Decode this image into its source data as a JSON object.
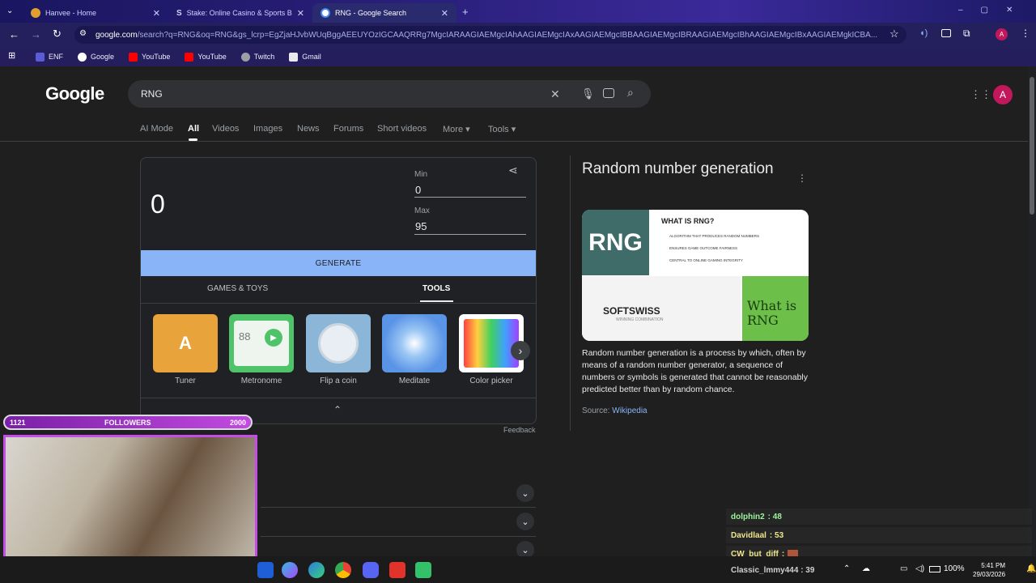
{
  "browser": {
    "tabs": [
      {
        "label": "Hanvee - Home"
      },
      {
        "label": "Stake: Online Casino & Sports B"
      },
      {
        "label": "RNG - Google Search"
      }
    ],
    "url_host": "google.com",
    "url_path": "/search?q=RNG&oq=RNG&gs_lcrp=EgZjaHJvbWUqBggAEEUYOzIGCAAQRRg7MgcIARAAGIAEMgcIAhAAGIAEMgcIAxAAGIAEMgcIBBAAGIAEMgcIBRAAGIAEMgcIBhAAGIAEMgcIBxAAGIAEMgkICBA...",
    "bookmarks": [
      "ENF",
      "Google",
      "YouTube",
      "YouTube",
      "Twitch",
      "Gmail"
    ],
    "profile_initial": "A"
  },
  "google": {
    "logo": "Google",
    "query": "RNG",
    "nav": [
      "AI Mode",
      "All",
      "Videos",
      "Images",
      "News",
      "Forums",
      "Short videos",
      "More",
      "Tools"
    ],
    "rng": {
      "value": "0",
      "min_label": "Min",
      "min_value": "0",
      "max_label": "Max",
      "max_value": "95",
      "generate": "GENERATE",
      "tab_games": "GAMES & TOYS",
      "tab_tools": "TOOLS",
      "tools": [
        "Tuner",
        "Metronome",
        "Flip a coin",
        "Meditate",
        "Color picker"
      ],
      "tuner_letter": "A",
      "metronome_value": "88",
      "feedback": "Feedback"
    },
    "knowledge": {
      "title": "Random number generation",
      "image_heading": "WHAT IS RNG?",
      "image_rng": "RNG",
      "image_points": [
        "ALGORITHM THAT PRODUCES RANDOM NUMBERS",
        "ENSURES GAME OUTCOME FAIRNESS",
        "CENTRAL TO ONLINE GAMING INTEGRITY"
      ],
      "image_softswiss": "SOFTSWISS",
      "image_softswiss_tag": "WINNING COMBINATION",
      "image_whatis": "What is RNG",
      "description": "Random number generation is a process by which, often by means of a random number generator, a sequence of numbers or symbols is generated that cannot be reasonably predicted better than by random chance.",
      "source_label": "Source:",
      "source_link": "Wikipedia"
    }
  },
  "stream": {
    "followers_current": "1121",
    "followers_label": "FOLLOWERS",
    "followers_goal": "2000",
    "followers_progress": 0.56,
    "chat": [
      {
        "user": "dolphin2",
        "text": ": 48",
        "color": "#9df59d"
      },
      {
        "user": "Davidlaal",
        "text": ": 53",
        "color": "#f0e68c"
      },
      {
        "user": "CW_but_diff",
        "text": ":",
        "color": "#f0e68c"
      },
      {
        "user": "Classic_lmmy444",
        "text": ": 39",
        "color": "#d0d0d0"
      }
    ]
  },
  "taskbar": {
    "battery": "100%",
    "time": "5:41 PM",
    "date": "29/03/2026"
  },
  "colors": {
    "accent": "#8ab4f8",
    "avatar": "#c2185b",
    "overlay": "#c44ce8"
  }
}
